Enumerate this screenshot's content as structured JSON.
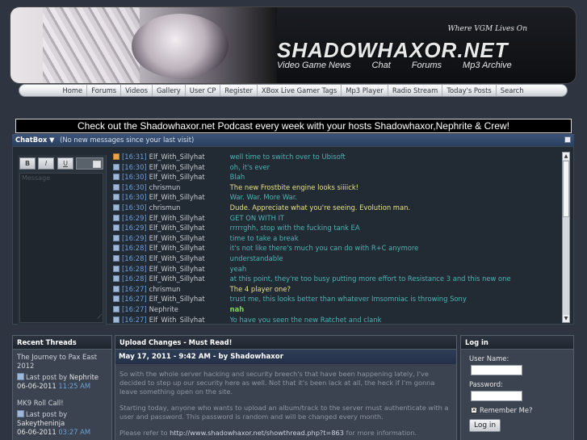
{
  "banner": {
    "tagline": "Where VGM Lives On",
    "logo": "SHADOWHAXOR.NET",
    "links": [
      "Video Game News",
      "Chat",
      "Forums",
      "Mp3 Archive"
    ]
  },
  "nav": [
    "Home",
    "Forums",
    "Videos",
    "Gallery",
    "User CP",
    "Register",
    "XBox Live Gamer Tags",
    "Mp3 Player",
    "Radio Stream",
    "Today's Posts",
    "Search"
  ],
  "podcast": "Check out the Shadowhaxor.net Podcast every week with your hosts Shadowhaxor,Nephrite & Crew!",
  "chatbox": {
    "title": "ChatBox",
    "subtitle": "(No new messages since your last visit)",
    "tools": {
      "bold": "B",
      "italic": "I",
      "underline": "U",
      "placeholder": "Message"
    },
    "messages": [
      {
        "time": "[16:31]",
        "user": "Elf_With_Sillyhat",
        "text": "well time to switch over to Ubisoft",
        "color": "teal",
        "icon": "orange"
      },
      {
        "time": "[16:30]",
        "user": "Elf_With_Sillyhat",
        "text": "oh, it's ever",
        "color": "teal",
        "icon": "blue"
      },
      {
        "time": "[16:30]",
        "user": "Elf_With_Sillyhat",
        "text": "Blah",
        "color": "teal",
        "icon": "blue"
      },
      {
        "time": "[16:30]",
        "user": "chrismun",
        "text": "The new Frostbite engine looks siiiick!",
        "color": "yellow",
        "icon": "blue"
      },
      {
        "time": "[16:30]",
        "user": "Elf_With_Sillyhat",
        "text": "War. War. More War.",
        "color": "teal",
        "icon": "blue"
      },
      {
        "time": "[16:30]",
        "user": "chrismun",
        "text": "Dude. Appreciate what you're seeing. Evolution man.",
        "color": "yellow",
        "icon": "blue"
      },
      {
        "time": "[16:29]",
        "user": "Elf_With_Sillyhat",
        "text": "GET ON WITH IT",
        "color": "teal",
        "icon": "blue"
      },
      {
        "time": "[16:29]",
        "user": "Elf_With_Sillyhat",
        "text": "rrrrrghh, stop with the fucking tank EA",
        "color": "teal",
        "icon": "blue"
      },
      {
        "time": "[16:29]",
        "user": "Elf_With_Sillyhat",
        "text": "time to take a break",
        "color": "teal",
        "icon": "blue"
      },
      {
        "time": "[16:28]",
        "user": "Elf_With_Sillyhat",
        "text": "it's not like there's much you can do with R+C anymore",
        "color": "teal",
        "icon": "blue"
      },
      {
        "time": "[16:28]",
        "user": "Elf_With_Sillyhat",
        "text": "understandable",
        "color": "teal",
        "icon": "blue"
      },
      {
        "time": "[16:28]",
        "user": "Elf_With_Sillyhat",
        "text": "yeah",
        "color": "teal",
        "icon": "blue"
      },
      {
        "time": "[16:28]",
        "user": "Elf_With_Sillyhat",
        "text": "at this point, they're too busy putting more effort to Resistance 3 and this new one",
        "color": "teal",
        "icon": "blue"
      },
      {
        "time": "[16:27]",
        "user": "chrismun",
        "text": "The 4 player one?",
        "color": "yellow",
        "icon": "blue"
      },
      {
        "time": "[16:27]",
        "user": "Elf_With_Sillyhat",
        "text": "trust me, this looks better than whatever Imsomniac is throwing Sony",
        "color": "teal",
        "icon": "blue"
      },
      {
        "time": "[16:27]",
        "user": "Nephrite",
        "text": "nah",
        "color": "green",
        "icon": "blue"
      },
      {
        "time": "[16:27]",
        "user": "Elf_With_Sillyhat",
        "text": "Yo have you seen the new Ratchet and clank",
        "color": "teal",
        "icon": "blue"
      }
    ]
  },
  "recent_threads": {
    "title": "Recent Threads",
    "last_post_label": "Last post by",
    "items": [
      {
        "title": "The Journey to Pax East 2012",
        "user": "Nephrite",
        "date": "06-06-2011",
        "time": "11:25 AM"
      },
      {
        "title": "MK9 Roll Call!",
        "user": "Sakeytheninja",
        "date": "06-06-2011",
        "time": "03:27 AM"
      }
    ]
  },
  "news": {
    "title": "Upload Changes - Must Read!",
    "date_line": "May 17, 2011 - 9:42 AM - by Shadowhaxor",
    "paragraphs": [
      "So with the whole server hacking and security breech's that have been happening lately, I've decided to step up our security here as well.  Not that it's been lack at all, the heck if I'm gonna leave something open on the site.",
      "Starting today, anyone who wants to upload an album/track to the server must authenticate with a user and password. This password is random and will be changed every month."
    ],
    "refer_prefix": "Please refer to",
    "refer_url": "http://www.shadowhaxor.net/showthread.php?t=863",
    "refer_suffix": "for more information."
  },
  "login": {
    "title": "Log in",
    "username_label": "User Name:",
    "password_label": "Password:",
    "remember_label": "Remember Me?",
    "button": "Log in"
  },
  "colors": {
    "teal": "#4fb3b5",
    "yellow": "#e8e08a",
    "green": "#7fd65a",
    "time_blue": "#6ea0d8",
    "header_blue": "#2a3f5e"
  }
}
